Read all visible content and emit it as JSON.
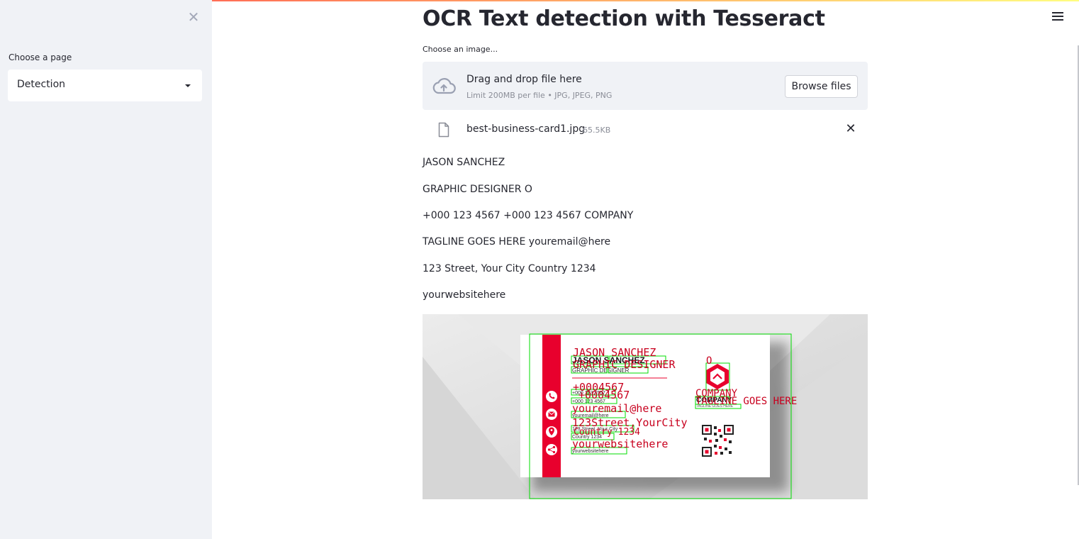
{
  "sidebar": {
    "close_icon": "close-icon",
    "select_label": "Choose a page",
    "select_value": "Detection"
  },
  "header": {
    "menu_icon": "hamburger-menu-icon"
  },
  "main": {
    "title": "OCR Text detection with Tesseract",
    "uploader": {
      "label": "Choose an image...",
      "drop_title": "Drag and drop file here",
      "drop_limit": "Limit 200MB per file • JPG, JPEG, PNG",
      "browse_label": "Browse files",
      "file_name": "best-business-card1.jpg",
      "file_size": "65.5KB"
    },
    "ocr_lines": [
      "JASON SANCHEZ",
      "GRAPHIC DESIGNER O",
      "+000 123 4567 +000 123 4567 COMPANY",
      "TAGLINE GOES HERE youremail@here",
      "123 Street, Your City Country 1234",
      "yourwebsitehere"
    ],
    "card": {
      "name": "JASON SANCHEZ",
      "role": "GRAPHIC DESIGNER",
      "phone1": "+000 123 4567",
      "phone2": "+000 123 4567",
      "email": "youremail@here",
      "address1": "123 Street, Your City",
      "address2": "Country 1234",
      "website": "yourwebsitehere",
      "company": "COMPANY",
      "tagline": "TAGLINE GOES HERE",
      "ocr_overlay": {
        "name": "JASON SANCHEZ",
        "role": "GRAPHIC DESIGNER",
        "o": "O",
        "phone_a": "+0004567",
        "phone_b": "+0004567",
        "company": "COMPANY",
        "tagline": "TAGLINE GOES HERE",
        "email": "youremail@here",
        "address": "123Street,YourCity",
        "country": "Country 1234",
        "website": "yourwebsitehere"
      },
      "colors": {
        "brand": "#e8002d",
        "box": "#00dd00",
        "overlay_text": "#c8001e"
      }
    }
  }
}
